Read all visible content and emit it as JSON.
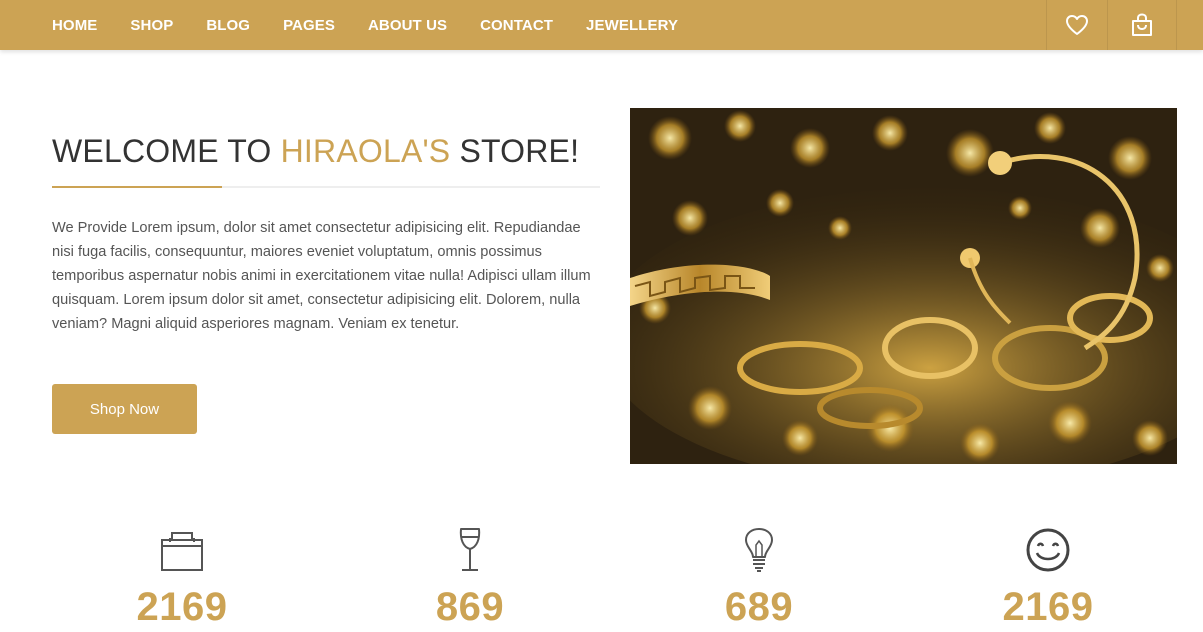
{
  "nav": {
    "items": [
      "HOME",
      "SHOP",
      "BLOG",
      "PAGES",
      "ABOUT US",
      "CONTACT",
      "JEWELLERY"
    ],
    "icons": [
      "heart-icon",
      "shopping-bag-icon"
    ],
    "color": "#cca354"
  },
  "welcome": {
    "title_prefix": "WELCOME TO ",
    "title_accent": "HIRAOLA'S",
    "title_suffix": " STORE!",
    "body": "We Provide Lorem ipsum, dolor sit amet consectetur adipisicing elit. Repudiandae nisi fuga facilis, consequuntur, maiores eveniet voluptatum, omnis possimus temporibus aspernatur nobis animi in exercitationem vitae nulla! Adipisci ullam illum quisquam. Lorem ipsum dolor sit amet, consectetur adipisicing elit. Dolorem, nulla veniam? Magni aliquid asperiores magnam. Veniam ex tenetur.",
    "button_label": "Shop Now"
  },
  "stats": [
    {
      "icon": "briefcase-icon",
      "value": "2169"
    },
    {
      "icon": "wine-glass-icon",
      "value": "869"
    },
    {
      "icon": "light-bulb-icon",
      "value": "689"
    },
    {
      "icon": "smiley-icon",
      "value": "2169"
    }
  ],
  "colors": {
    "accent": "#cca354",
    "text": "#333333"
  }
}
